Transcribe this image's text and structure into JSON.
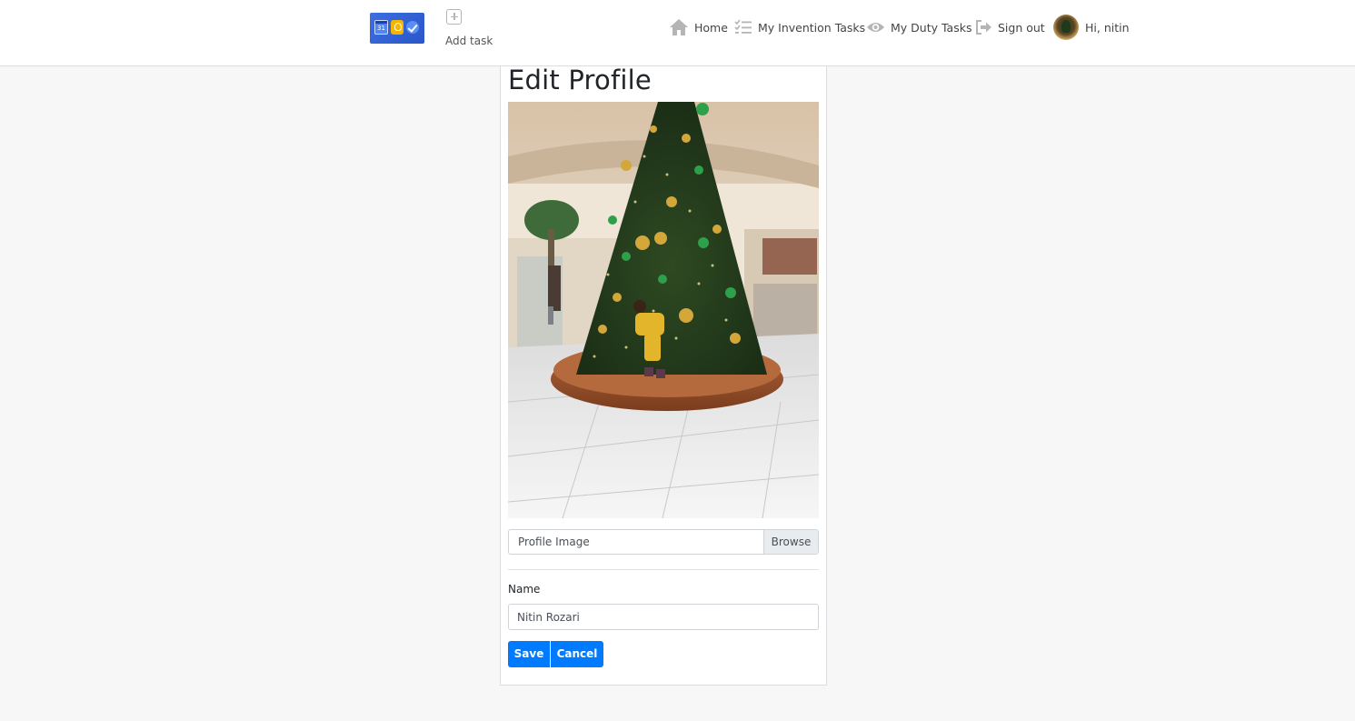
{
  "header": {
    "logo_day": "31",
    "add_task_label": "Add task",
    "nav": {
      "home": "Home",
      "invention_tasks": "My Invention Tasks",
      "duty_tasks": "My Duty Tasks",
      "sign_out": "Sign out",
      "greeting": "Hi, nitin"
    }
  },
  "form": {
    "title": "Edit Profile",
    "file_placeholder": "Profile Image",
    "browse_label": "Browse",
    "name_label": "Name",
    "name_value": "Nitin Rozari",
    "save_label": "Save",
    "cancel_label": "Cancel"
  },
  "colors": {
    "primary": "#007bff",
    "page_bg": "#f7f7f7"
  }
}
